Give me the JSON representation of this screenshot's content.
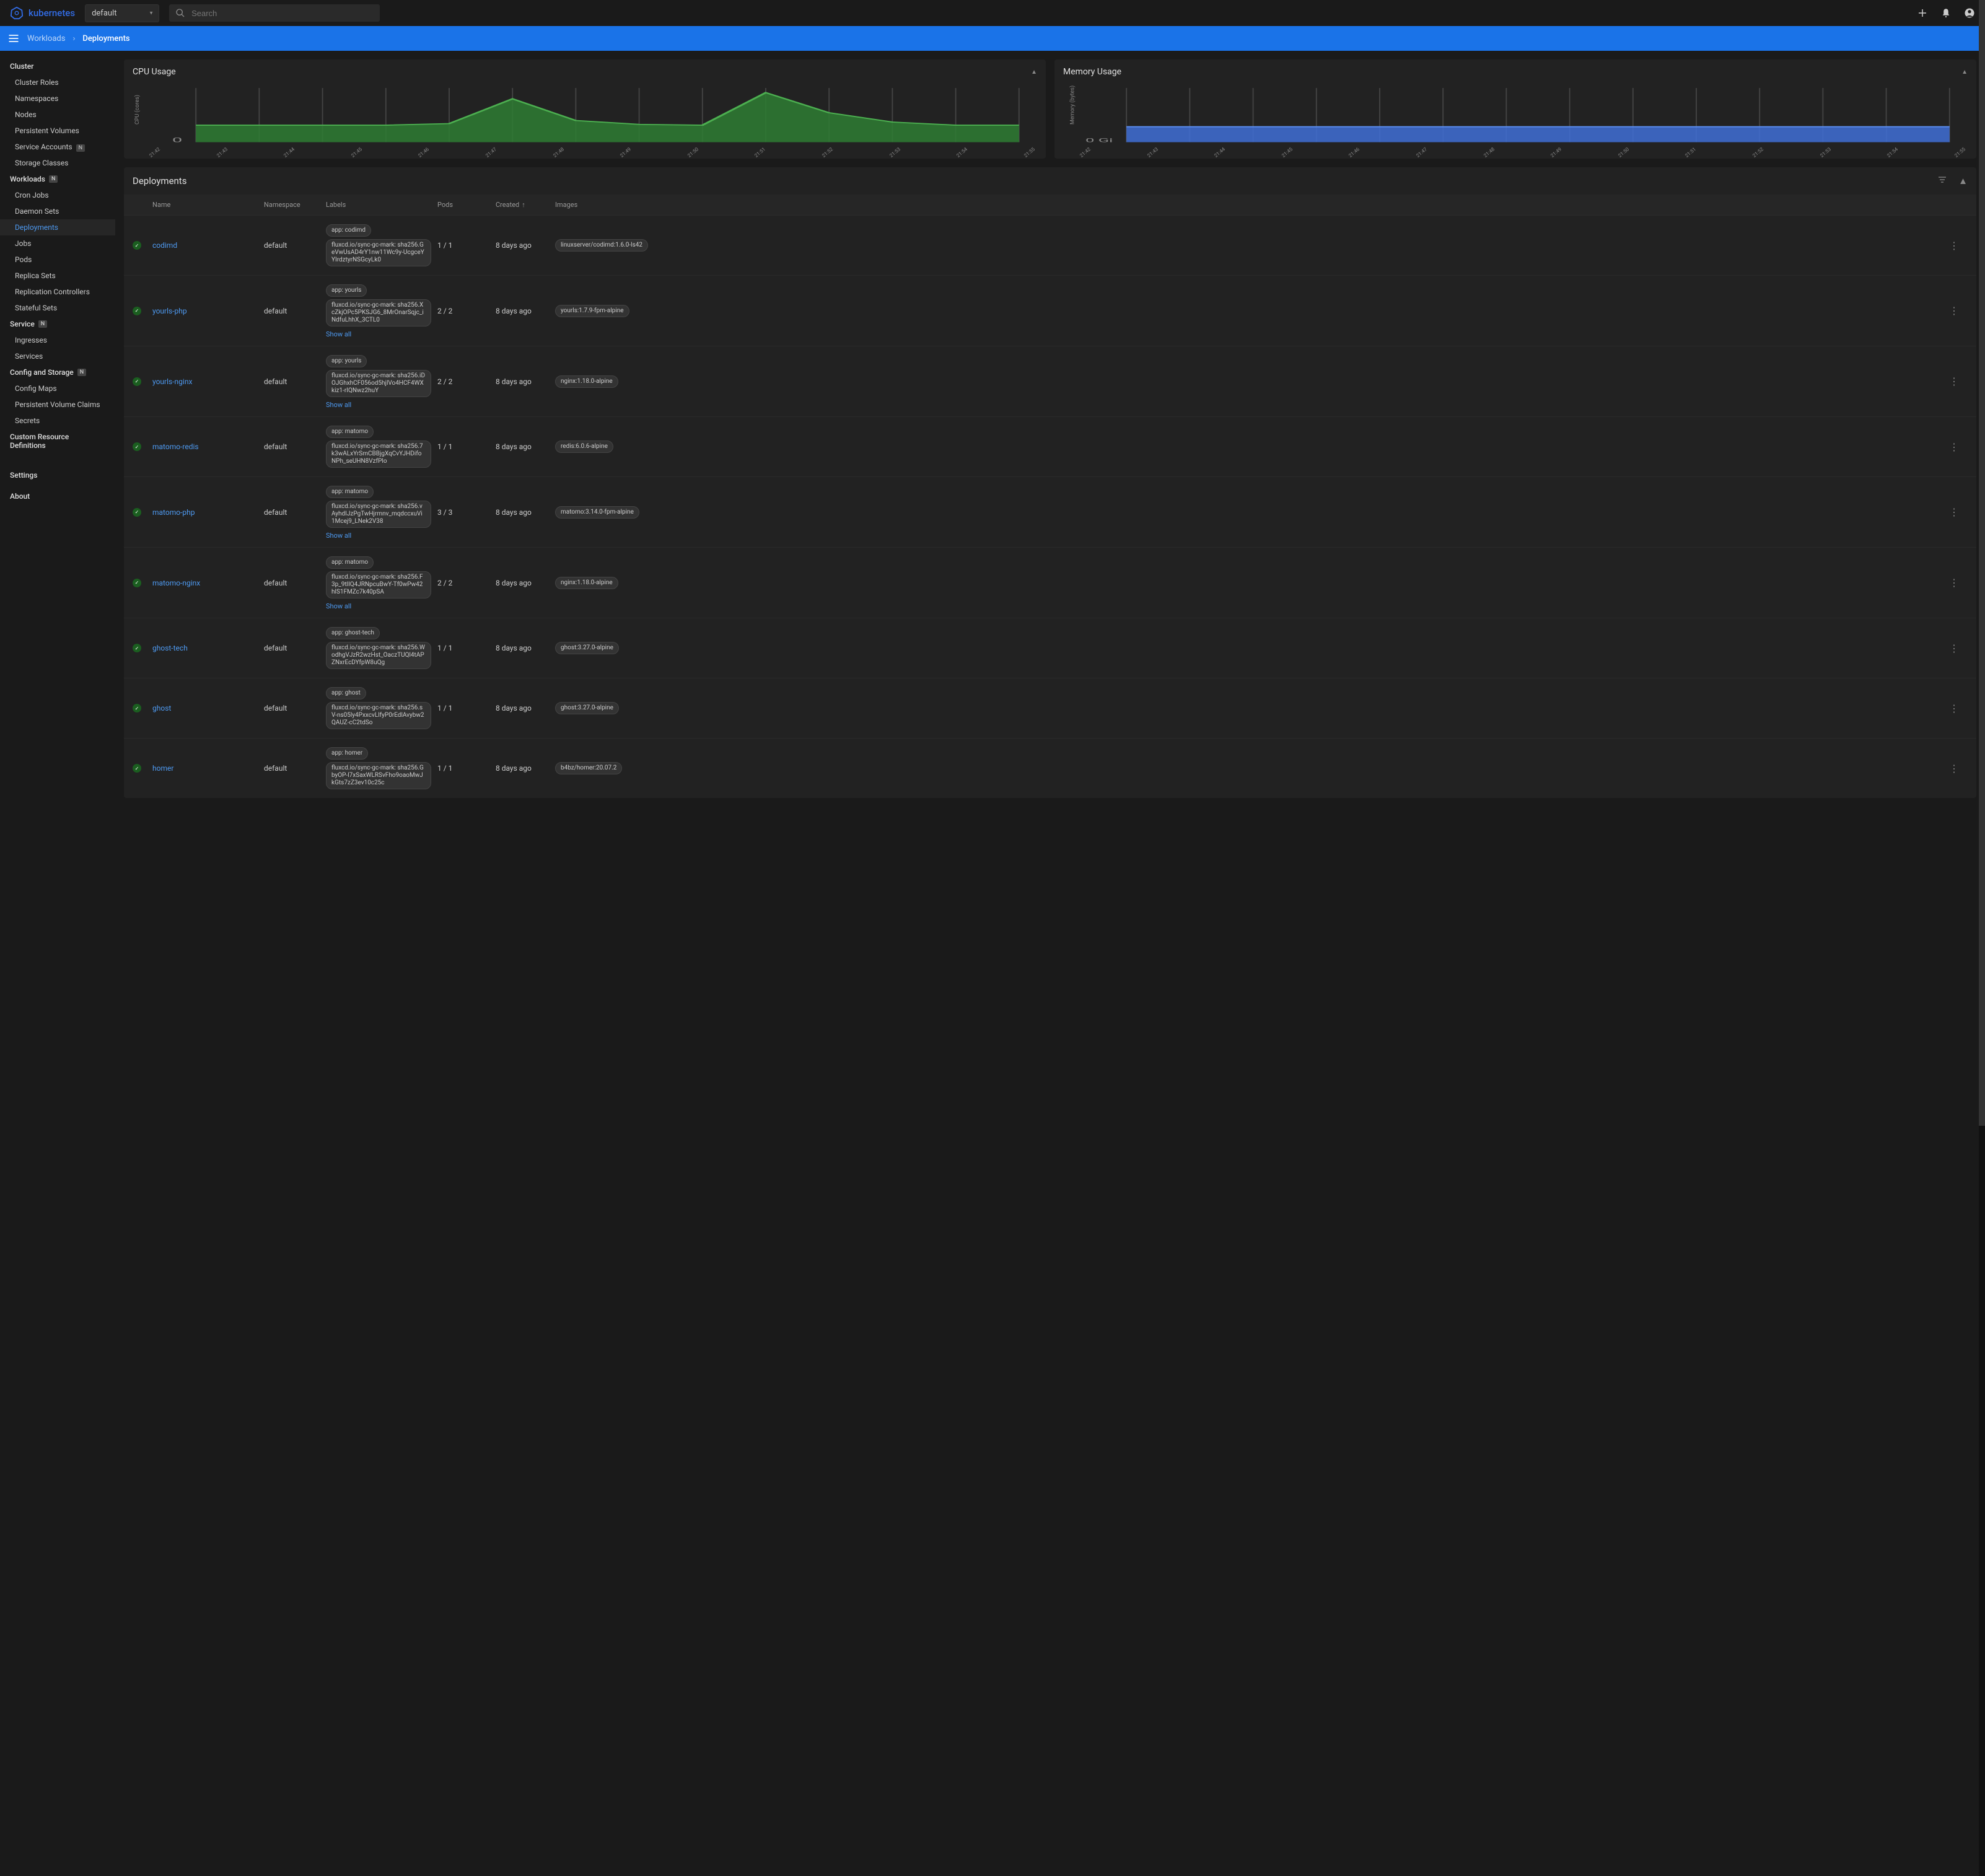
{
  "brand": "kubernetes",
  "namespace_selector": "default",
  "search_placeholder": "Search",
  "breadcrumb": {
    "parent": "Workloads",
    "current": "Deployments"
  },
  "sidebar": {
    "sections": [
      {
        "title": "Cluster",
        "badge": null,
        "items": [
          {
            "label": "Cluster Roles"
          },
          {
            "label": "Namespaces"
          },
          {
            "label": "Nodes"
          },
          {
            "label": "Persistent Volumes"
          },
          {
            "label": "Service Accounts",
            "badge": "N"
          },
          {
            "label": "Storage Classes"
          }
        ]
      },
      {
        "title": "Workloads",
        "badge": "N",
        "items": [
          {
            "label": "Cron Jobs"
          },
          {
            "label": "Daemon Sets"
          },
          {
            "label": "Deployments",
            "active": true
          },
          {
            "label": "Jobs"
          },
          {
            "label": "Pods"
          },
          {
            "label": "Replica Sets"
          },
          {
            "label": "Replication Controllers"
          },
          {
            "label": "Stateful Sets"
          }
        ]
      },
      {
        "title": "Service",
        "badge": "N",
        "items": [
          {
            "label": "Ingresses"
          },
          {
            "label": "Services"
          }
        ]
      },
      {
        "title": "Config and Storage",
        "badge": "N",
        "items": [
          {
            "label": "Config Maps"
          },
          {
            "label": "Persistent Volume Claims"
          },
          {
            "label": "Secrets"
          }
        ]
      },
      {
        "title": "Custom Resource Definitions",
        "badge": null,
        "items": []
      }
    ],
    "footer": [
      {
        "label": "Settings"
      },
      {
        "label": "About"
      }
    ]
  },
  "charts": {
    "cpu": {
      "title": "CPU Usage",
      "ylabel": "CPU (cores)",
      "y_zero": "0"
    },
    "mem": {
      "title": "Memory Usage",
      "ylabel": "Memory (bytes)",
      "y_zero": "0 Gi"
    },
    "ticks": [
      "21:42",
      "21:43",
      "21:44",
      "21:45",
      "21:46",
      "21:47",
      "21:48",
      "21:49",
      "21:50",
      "21:51",
      "21:52",
      "21:53",
      "21:54",
      "21:55"
    ]
  },
  "chart_data": [
    {
      "type": "area",
      "title": "CPU Usage",
      "xlabel": "",
      "ylabel": "CPU (cores)",
      "x": [
        "21:42",
        "21:43",
        "21:44",
        "21:45",
        "21:46",
        "21:47",
        "21:48",
        "21:49",
        "21:50",
        "21:51",
        "21:52",
        "21:53",
        "21:54",
        "21:55"
      ],
      "values": [
        0.35,
        0.35,
        0.35,
        0.35,
        0.38,
        0.85,
        0.45,
        0.37,
        0.35,
        1.0,
        0.6,
        0.4,
        0.35,
        0.35
      ],
      "ylim": [
        0,
        1.0
      ],
      "color": "#2e7d32"
    },
    {
      "type": "area",
      "title": "Memory Usage",
      "xlabel": "",
      "ylabel": "Memory (bytes)",
      "x": [
        "21:42",
        "21:43",
        "21:44",
        "21:45",
        "21:46",
        "21:47",
        "21:48",
        "21:49",
        "21:50",
        "21:51",
        "21:52",
        "21:53",
        "21:54",
        "21:55"
      ],
      "values": [
        0.3,
        0.3,
        0.3,
        0.3,
        0.3,
        0.3,
        0.3,
        0.3,
        0.3,
        0.3,
        0.3,
        0.3,
        0.3,
        0.3
      ],
      "ylim": [
        0,
        1.0
      ],
      "color": "#3f6fd6",
      "note": "Y-axis shows 0 Gi baseline; flat usage at ~30% of shown range"
    }
  ],
  "table": {
    "title": "Deployments",
    "columns": {
      "name": "Name",
      "namespace": "Namespace",
      "labels": "Labels",
      "pods": "Pods",
      "created": "Created",
      "images": "Images"
    },
    "sort_icon": "↑",
    "show_all_label": "Show all",
    "rows": [
      {
        "name": "codimd",
        "namespace": "default",
        "labels": [
          "app: codimd",
          "fluxcd.io/sync-gc-mark: sha256.GeVwUsAD4rY1nw11Wc9y-UcgceYYIrdztyrNSGcyLk0"
        ],
        "show_all": false,
        "pods": "1 / 1",
        "created": "8 days ago",
        "images": [
          "linuxserver/codimd:1.6.0-ls42"
        ]
      },
      {
        "name": "yourls-php",
        "namespace": "default",
        "labels": [
          "app: yourls",
          "fluxcd.io/sync-gc-mark: sha256.XcZkjOPc5PKSJG6_8MrOnarSqjc_iNdfuLhhX_3CTL0"
        ],
        "show_all": true,
        "pods": "2 / 2",
        "created": "8 days ago",
        "images": [
          "yourls:1.7.9-fpm-alpine"
        ]
      },
      {
        "name": "yourls-nginx",
        "namespace": "default",
        "labels": [
          "app: yourls",
          "fluxcd.io/sync-gc-mark: sha256.iDOJGhxhCF056od5hjlVo4HCF4WXkiz1-rIQNwz2huY"
        ],
        "show_all": true,
        "pods": "2 / 2",
        "created": "8 days ago",
        "images": [
          "nginx:1.18.0-alpine"
        ]
      },
      {
        "name": "matomo-redis",
        "namespace": "default",
        "labels": [
          "app: matomo",
          "fluxcd.io/sync-gc-mark: sha256.7k3wALxYrSmCBBjgXqCvYJHDifoNPh_seUHN8VzfPlo"
        ],
        "show_all": false,
        "pods": "1 / 1",
        "created": "8 days ago",
        "images": [
          "redis:6.0.6-alpine"
        ]
      },
      {
        "name": "matomo-php",
        "namespace": "default",
        "labels": [
          "app: matomo",
          "fluxcd.io/sync-gc-mark: sha256.vAyhdIJzPgTwHjrmnv_mqdccxuVi1Mcej9_LNek2V38"
        ],
        "show_all": true,
        "pods": "3 / 3",
        "created": "8 days ago",
        "images": [
          "matomo:3.14.0-fpm-alpine"
        ]
      },
      {
        "name": "matomo-nginx",
        "namespace": "default",
        "labels": [
          "app: matomo",
          "fluxcd.io/sync-gc-mark: sha256.F3p_9tlIQ4JRNpcuBwY-Tf0wPw42hlS1FMZc7k40pSA"
        ],
        "show_all": true,
        "pods": "2 / 2",
        "created": "8 days ago",
        "images": [
          "nginx:1.18.0-alpine"
        ]
      },
      {
        "name": "ghost-tech",
        "namespace": "default",
        "labels": [
          "app: ghost-tech",
          "fluxcd.io/sync-gc-mark: sha256.WodhgVJzR2wzHst_OaczTUQl4tAPZNxrEcDYfpW8uQg"
        ],
        "show_all": false,
        "pods": "1 / 1",
        "created": "8 days ago",
        "images": [
          "ghost:3.27.0-alpine"
        ]
      },
      {
        "name": "ghost",
        "namespace": "default",
        "labels": [
          "app: ghost",
          "fluxcd.io/sync-gc-mark: sha256.sV-ns05ly4PxxcvLlfyP0rEdlAvybw2QAUZ-cC2tdSo"
        ],
        "show_all": false,
        "pods": "1 / 1",
        "created": "8 days ago",
        "images": [
          "ghost:3.27.0-alpine"
        ]
      },
      {
        "name": "homer",
        "namespace": "default",
        "labels": [
          "app: homer",
          "fluxcd.io/sync-gc-mark: sha256.GbyOP-l7xSaxWLRSvFho9oaoMwJkGts7zZ3ev10c25c"
        ],
        "show_all": false,
        "pods": "1 / 1",
        "created": "8 days ago",
        "images": [
          "b4bz/homer:20.07.2"
        ]
      }
    ]
  }
}
